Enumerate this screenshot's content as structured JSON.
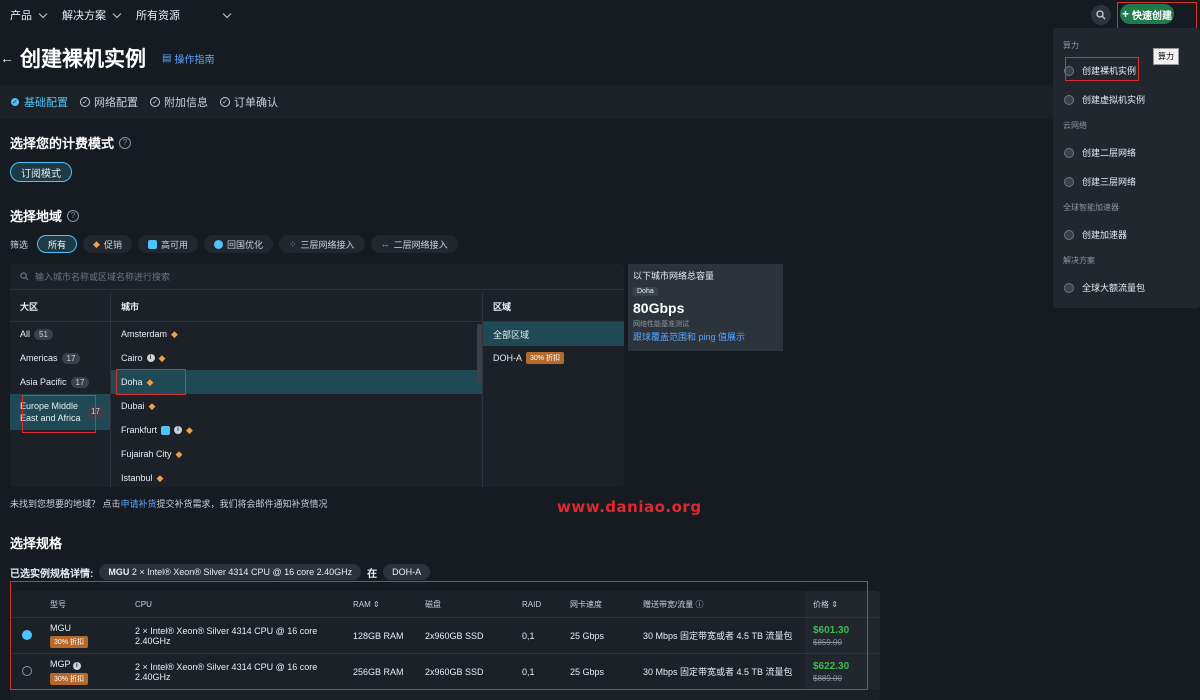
{
  "topnav": {
    "items": [
      {
        "label": "产品"
      },
      {
        "label": "解决方案"
      },
      {
        "label": "所有资源"
      }
    ],
    "create_label": "快速创建"
  },
  "page": {
    "title": "创建裸机实例",
    "guide": "操作指南"
  },
  "steps": [
    "基础配置",
    "网络配置",
    "附加信息",
    "订单确认"
  ],
  "billing": {
    "title": "选择您的计费模式",
    "mode": "订阅模式"
  },
  "region": {
    "title": "选择地域",
    "filter_label": "筛选",
    "filters": [
      "所有",
      "促销",
      "高可用",
      "回国优化",
      "三层网络接入",
      "二层网络接入"
    ],
    "search_placeholder": "输入城市名称或区域名称进行搜索",
    "continent_header": "大区",
    "city_header": "城市",
    "zone_header": "区域",
    "continents": [
      {
        "name": "All",
        "count": "51"
      },
      {
        "name": "Americas",
        "count": "17"
      },
      {
        "name": "Asia Pacific",
        "count": "17"
      },
      {
        "name": "Europe Middle East and Africa",
        "count": "17"
      }
    ],
    "cities": [
      "Amsterdam",
      "Cairo",
      "Doha",
      "Dubai",
      "Frankfurt",
      "Fujairah City",
      "Istanbul"
    ],
    "zones": [
      {
        "name": "全部区域",
        "tag": ""
      },
      {
        "name": "DOH-A",
        "tag": "30% 折扣"
      }
    ],
    "capacity": {
      "title": "以下城市网络总容量",
      "city": "Doha",
      "value": "80Gbps",
      "sub": "网络性能基准测试",
      "link": "跟球覆盖范围和 ping 值展示"
    },
    "notfound_prefix": "未找到您想要的地域？ 点击",
    "notfound_link": "申请补货",
    "notfound_suffix": "提交补货需求，我们将会邮件通知补货情况"
  },
  "watermark": "www.daniao.org",
  "spec": {
    "title": "选择规格",
    "selected_label": "已选实例规格详情:",
    "selected_model": "MGU",
    "selected_desc": "2 × Intel® Xeon® Silver 4314 CPU @ 16 core 2.40GHz",
    "in_label": "在",
    "selected_zone": "DOH-A",
    "headers": [
      "型号",
      "CPU",
      "RAM ⇕",
      "磁盘",
      "RAID",
      "网卡速度",
      "赠送带宽/流量 ⓘ",
      "价格 ⇕"
    ],
    "rows": [
      {
        "model": "MGU",
        "tag": "30% 折扣",
        "cpu": "2 × Intel® Xeon® Silver 4314 CPU @ 16 core 2.40GHz",
        "ram": "128GB RAM",
        "disk": "2x960GB SSD",
        "raid": "0,1",
        "nic": "25 Gbps",
        "bw": "30 Mbps 固定带宽或者 4.5 TB 流量包",
        "price": "$601.30",
        "old": "$859.00",
        "selected": true
      },
      {
        "model": "MGP",
        "tag": "30% 折扣",
        "cpu": "2 × Intel® Xeon® Silver 4314 CPU @ 16 core 2.40GHz",
        "ram": "256GB RAM",
        "disk": "2x960GB SSD",
        "raid": "0,1",
        "nic": "25 Gbps",
        "bw": "30 Mbps 固定带宽或者 4.5 TB 流量包",
        "price": "$622.30",
        "old": "$889.00",
        "selected": false
      }
    ]
  },
  "dropdown": {
    "groups": [
      {
        "label": "算力",
        "items": [
          "创建裸机实例",
          "创建虚拟机实例"
        ]
      },
      {
        "label": "云网络",
        "items": [
          "创建二层网络",
          "创建三层网络"
        ]
      },
      {
        "label": "全球智能加速器",
        "items": [
          "创建加速器"
        ]
      },
      {
        "label": "解决方案",
        "items": [
          "全球大额流量包"
        ]
      }
    ],
    "tooltip": "算力"
  }
}
